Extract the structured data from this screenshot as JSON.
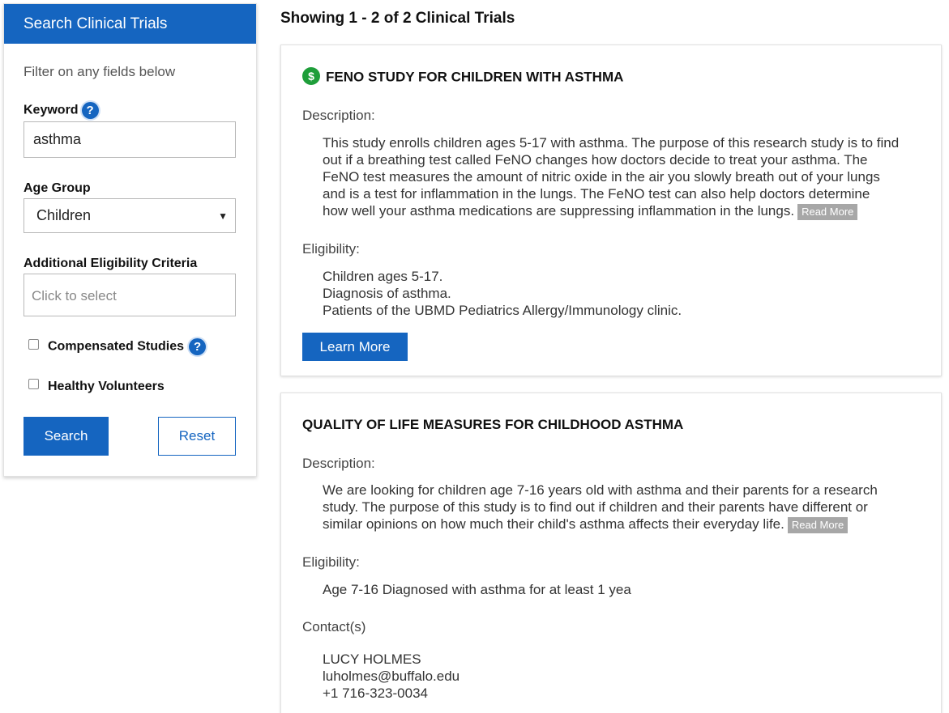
{
  "sidebar": {
    "title": "Search Clinical Trials",
    "filter_hint": "Filter on any fields below",
    "keyword_label": "Keyword",
    "keyword_value": "asthma",
    "help_glyph": "?",
    "age_group_label": "Age Group",
    "age_group_value": "Children",
    "criteria_label": "Additional Eligibility Criteria",
    "criteria_placeholder": "Click to select",
    "compensated_label": "Compensated Studies",
    "compensated_checked": false,
    "healthy_label": "Healthy Volunteers",
    "healthy_checked": false,
    "search_label": "Search",
    "reset_label": "Reset"
  },
  "results": {
    "heading": "Showing 1 - 2 of 2 Clinical Trials"
  },
  "trials": [
    {
      "title": "FENO STUDY FOR CHILDREN WITH ASTHMA",
      "compensated": true,
      "dollar_glyph": "$",
      "description_label": "Description:",
      "description_lines": [
        "This study enrolls children ages 5-17 with asthma. The purpose of this research study is to find",
        "out if a breathing test called FeNO changes how doctors decide to treat your asthma. The",
        "FeNO test measures the amount of nitric oxide in the air you slowly breath out of your lungs",
        "and is a test for inflammation in the lungs. The FeNO test can also help doctors determine",
        "how well your asthma medications are suppressing inflammation in the lungs."
      ],
      "read_more": "Read More",
      "eligibility_label": "Eligibility:",
      "eligibility_lines": [
        "Children ages 5-17.",
        "Diagnosis of asthma.",
        "Patients of the UBMD Pediatrics Allergy/Immunology clinic."
      ],
      "learn_more": "Learn More"
    },
    {
      "title": "QUALITY OF LIFE MEASURES FOR CHILDHOOD ASTHMA",
      "compensated": false,
      "description_label": "Description:",
      "description_lines": [
        "We are looking for children age 7-16 years old with asthma and their parents for a research",
        "study. The purpose of this study is to find out if children and their parents have different or",
        "similar opinions on how much their child's asthma affects their everyday life."
      ],
      "read_more": "Read More",
      "eligibility_label": "Eligibility:",
      "eligibility_lines": [
        "Age 7-16 Diagnosed with asthma for at least 1 yea"
      ],
      "contacts_label": "Contact(s)",
      "contact_name": "LUCY HOLMES",
      "contact_email": "luholmes@buffalo.edu",
      "contact_phone": "+1 716-323-0034"
    }
  ],
  "colors": {
    "brand_blue": "#1565c0",
    "compensation_green": "#1e9e3a",
    "read_more_gray": "#a7a7a7"
  },
  "icons": {
    "help": "question-circle-icon",
    "compensation": "dollar-circle-icon",
    "select_caret": "caret-down-icon"
  }
}
